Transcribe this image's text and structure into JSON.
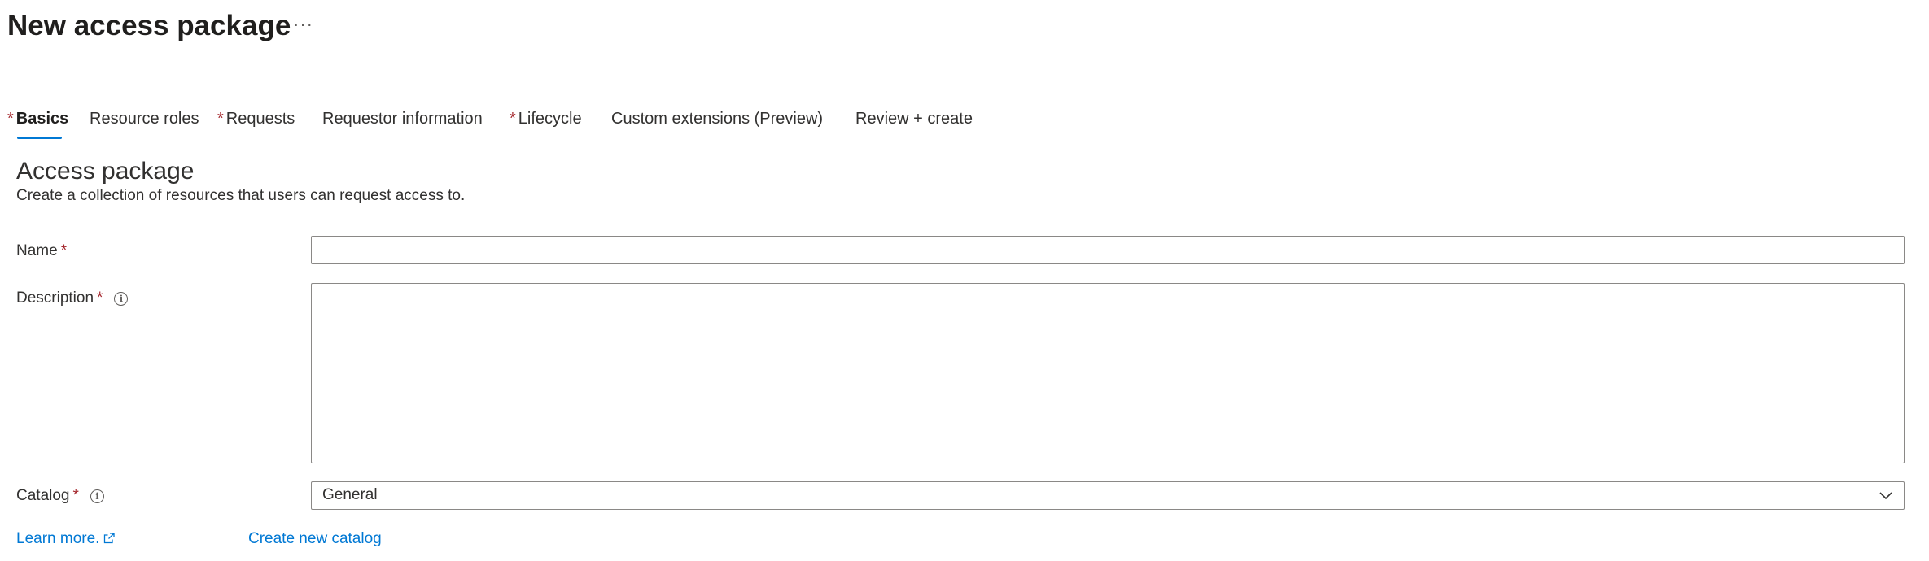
{
  "header": {
    "title": "New access package",
    "more_glyph": "···"
  },
  "tabs": [
    {
      "label": "Basics",
      "required": true,
      "active": true
    },
    {
      "label": "Resource roles",
      "required": false
    },
    {
      "label": "Requests",
      "required": true
    },
    {
      "label": "Requestor information",
      "required": false
    },
    {
      "label": "Lifecycle",
      "required": true
    },
    {
      "label": "Custom extensions (Preview)",
      "required": false
    },
    {
      "label": "Review + create",
      "required": false
    }
  ],
  "required_marker": "*",
  "section": {
    "title": "Access package",
    "description": "Create a collection of resources that users can request access to."
  },
  "form": {
    "name": {
      "label": "Name",
      "value": ""
    },
    "description": {
      "label": "Description",
      "value": "",
      "info_icon": "info-icon"
    },
    "catalog": {
      "label": "Catalog",
      "value": "General",
      "info_icon": "info-icon",
      "dropdown_icon": "chevron-down-icon"
    }
  },
  "links": {
    "learn_more": "Learn more.",
    "create_catalog": "Create new catalog"
  },
  "colors": {
    "accent": "#0078d4",
    "required": "#a4262c",
    "text": "#323130",
    "border": "#8a8886"
  }
}
